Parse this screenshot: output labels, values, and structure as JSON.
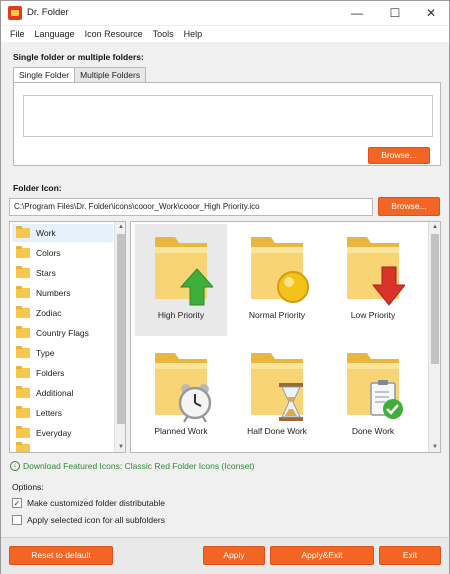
{
  "window": {
    "title": "Dr. Folder",
    "controls": {
      "minimize": "—",
      "maximize": "☐",
      "close": "✕"
    }
  },
  "menu": [
    "File",
    "Language",
    "Icon Resource",
    "Tools",
    "Help"
  ],
  "folders_section": {
    "label": "Single folder or multiple folders:",
    "tabs": [
      "Single Folder",
      "Multiple Folders"
    ],
    "active_tab": "Single Folder",
    "browse_label": "Browse..."
  },
  "icons_section": {
    "label": "Folder Icon:",
    "path_value": "C:\\Program Files\\Dr. Folder\\icons\\cooor_Work\\cooor_High Priority.ico",
    "browse_label": "Browse..."
  },
  "categories": [
    "Work",
    "Colors",
    "Stars",
    "Numbers",
    "Zodiac",
    "Country Flags",
    "Type",
    "Folders",
    "Additional",
    "Letters",
    "Everyday"
  ],
  "selected_category": "Work",
  "icons": [
    {
      "label": "High Priority",
      "icon": "folder-green-up-arrow-icon"
    },
    {
      "label": "Normal Priority",
      "icon": "folder-yellow-circle-icon"
    },
    {
      "label": "Low Priority",
      "icon": "folder-red-down-arrow-icon"
    },
    {
      "label": "Planned Work",
      "icon": "folder-alarm-clock-icon"
    },
    {
      "label": "Half Done Work",
      "icon": "folder-hourglass-icon"
    },
    {
      "label": "Done Work",
      "icon": "folder-clipboard-check-icon"
    }
  ],
  "selected_icon": "High Priority",
  "download_text": "Download Featured Icons: Classic Red Folder Icons (Iconset)",
  "options": {
    "label": "Options:",
    "items": [
      {
        "label": "Make customized folder distributable",
        "checked": true
      },
      {
        "label": "Apply selected icon for all subfolders",
        "checked": false
      }
    ]
  },
  "buttons": {
    "reset": "Reset to default",
    "apply": "Apply",
    "apply_exit": "Apply&Exit",
    "exit": "Exit"
  },
  "colors": {
    "accent": "#f26522",
    "folder": "#f5c74c",
    "link": "#2e8b34"
  }
}
